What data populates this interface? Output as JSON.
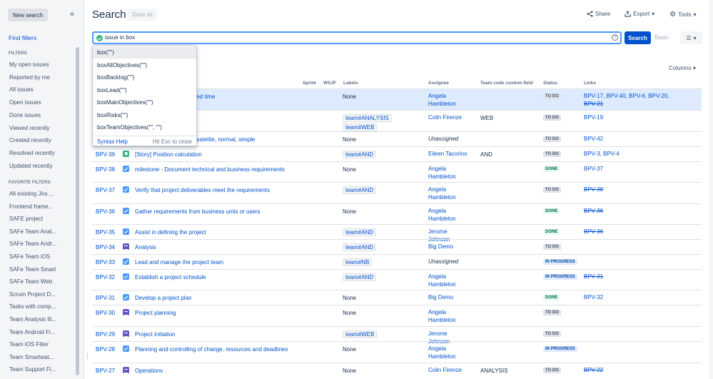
{
  "sidebar": {
    "new_search": "New search",
    "find_filters": "Find filters",
    "filters_heading": "FILTERS",
    "filters": [
      "My open issues",
      "Reported by me",
      "All issues",
      "Open issues",
      "Done issues",
      "Viewed recently",
      "Created recently",
      "Resolved recently",
      "Updated recently"
    ],
    "favorites_heading": "FAVORITE FILTERS",
    "favorites": [
      "All existing Jira ...",
      "Frontend frame...",
      "SAFE project",
      "SAFe Team Anal...",
      "SAFe Team Andr...",
      "SAFe Team iOS",
      "SAFe Team Smart",
      "SAFe Team Web",
      "Scrum Project D...",
      "Tasks with comp...",
      "Team Analysis fil...",
      "Team Android Fi...",
      "Team iOS Filter",
      "Team Smartwat...",
      "Team Support Fi..."
    ]
  },
  "header": {
    "title": "Search",
    "save_as": "Save as",
    "share": "Share",
    "export": "Export",
    "tools": "Tools"
  },
  "query": {
    "value": "issue in box",
    "search_label": "Search",
    "basic_label": "Basic",
    "help": "?"
  },
  "columns_label": "Columns",
  "autocomplete": {
    "items": [
      "box(\"\")",
      "boxAllObjectives(\"\")",
      "boxBacklog(\"\")",
      "boxLead(\"\")",
      "boxMainObjectives(\"\")",
      "boxRisks(\"\")",
      "boxTeamObjectives(\"\", \"\")"
    ],
    "syntax_help": "Syntax Help",
    "esc_hint": "Hit Esc to close"
  },
  "table": {
    "headers": {
      "sprint": "Sprint",
      "wsjf": "WSJF",
      "labels": "Labels",
      "assignee": "Assignee",
      "team_code": "Team code custom field",
      "status": "Status",
      "links": "Links"
    },
    "rows": [
      {
        "key": "",
        "type": "",
        "summary": "imated time",
        "labels": [
          "None"
        ],
        "assignee": "Angela Hambleton",
        "team": "",
        "status": "TO DO",
        "status_kind": "todo",
        "links": "BPV-17, BPV-40, BPV-6, BPV-20,",
        "links2": "BPV-21",
        "links2_strike": true
      },
      {
        "key": "",
        "type": "",
        "summary": "",
        "labels": [
          "team#ANALYSIS",
          "team#WEB"
        ],
        "assignee": "Colin Firenze",
        "team": "WEB",
        "status": "TO DO",
        "status_kind": "todo",
        "links": "BPV-19",
        "links2": ""
      },
      {
        "key": "",
        "type": "",
        "summary": "es - satelite, normal, simple",
        "labels": [
          "None"
        ],
        "assignee": "Unassigned",
        "team": "",
        "status": "TO DO",
        "status_kind": "todo",
        "links": "BPV-42",
        "links2": ""
      },
      {
        "key": "BPV-39",
        "type": "story",
        "summary": "[Story] Position calculation",
        "labels": [
          "team#AND"
        ],
        "assignee": "Eileen Tacorino",
        "team": "AND",
        "status": "TO DO",
        "status_kind": "todo",
        "links": "BPV-3, BPV-4",
        "links2": ""
      },
      {
        "key": "BPV-38",
        "type": "task",
        "summary": "milestone - Document technical and business requirements",
        "labels": [
          "None"
        ],
        "assignee": "Angela Hambleton",
        "team": "",
        "status": "DONE",
        "status_kind": "done",
        "links": "BPV-37",
        "links2": ""
      },
      {
        "key": "BPV-37",
        "type": "task",
        "summary": "Verify that project deliverables meet the requirements",
        "labels": [
          "team#AND"
        ],
        "assignee": "Angela Hambleton",
        "team": "",
        "status": "TO DO",
        "status_kind": "todo",
        "links": "BPV-38",
        "links_strike": true,
        "links2": ""
      },
      {
        "key": "BPV-36",
        "type": "task",
        "summary": "Gather requirements from business units or users",
        "labels": [
          "None"
        ],
        "assignee": "Angela Hambleton",
        "team": "",
        "status": "DONE",
        "status_kind": "done",
        "links": "BPV-36",
        "links_strike": true,
        "links2": ""
      },
      {
        "key": "BPV-35",
        "type": "task",
        "summary": "Assist in defining the project",
        "labels": [
          "team#AND"
        ],
        "assignee": "Jerome Johnson",
        "team": "",
        "status": "DONE",
        "status_kind": "done",
        "links": "BPV-36",
        "links_strike": true,
        "links2": ""
      },
      {
        "key": "BPV-34",
        "type": "doc",
        "summary": "Analysis",
        "labels": [
          "team#AND"
        ],
        "assignee": "Big Demo",
        "team": "",
        "status": "TO DO",
        "status_kind": "todo",
        "links": "",
        "links2": ""
      },
      {
        "key": "BPV-33",
        "type": "task",
        "summary": "Lead and manage the project team",
        "labels": [
          "team#NB"
        ],
        "assignee": "Unassigned",
        "team": "",
        "status": "IN PROGRESS",
        "status_kind": "prog",
        "links": "",
        "links2": ""
      },
      {
        "key": "BPV-32",
        "type": "task",
        "summary": "Establish a project schedule",
        "labels": [
          "team#AND"
        ],
        "assignee": "Angela Hambleton",
        "team": "",
        "status": "IN PROGRESS",
        "status_kind": "prog",
        "links": "BPV-31",
        "links_strike": true,
        "links2": ""
      },
      {
        "key": "BPV-31",
        "type": "task",
        "summary": "Develop a project plan",
        "labels": [
          "None"
        ],
        "assignee": "Big Demo",
        "team": "",
        "status": "DONE",
        "status_kind": "done",
        "links": "BPV-32",
        "links2": ""
      },
      {
        "key": "BPV-30",
        "type": "doc",
        "summary": "Project planning",
        "labels": [
          "None"
        ],
        "assignee": "Angela Hambleton",
        "team": "",
        "status": "TO DO",
        "status_kind": "todo",
        "links": "",
        "links2": ""
      },
      {
        "key": "BPV-29",
        "type": "doc",
        "summary": "Project initiation",
        "labels": [
          "team#WEB"
        ],
        "assignee": "Jerome Johnson",
        "team": "",
        "status": "TO DO",
        "status_kind": "todo",
        "links": "",
        "links2": ""
      },
      {
        "key": "BPV-28",
        "type": "task",
        "summary": "Planning and controlling of change, resources and deadlines",
        "labels": [
          "None"
        ],
        "assignee": "Angela Hambleton",
        "team": "",
        "status": "IN PROGRESS",
        "status_kind": "prog",
        "links": "",
        "links2": ""
      },
      {
        "key": "BPV-27",
        "type": "doc",
        "summary": "Operations",
        "labels": [
          "None"
        ],
        "assignee": "Colin Firenze",
        "team": "ANALYSIS",
        "status": "TO DO",
        "status_kind": "todo",
        "links": "BPV-22",
        "links_strike": true,
        "links2": ""
      }
    ]
  },
  "colors": {
    "accent": "#0052cc",
    "focus": "#4c9aff",
    "selected_row": "#deebff"
  }
}
